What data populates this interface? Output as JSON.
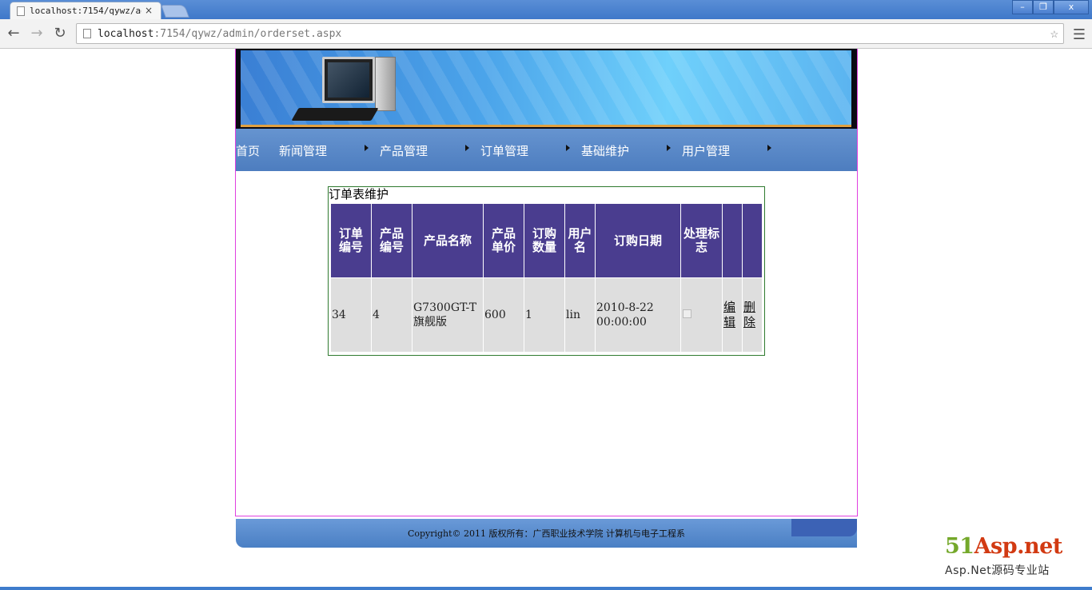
{
  "browser": {
    "tab_title": "localhost:7154/qywz/adm",
    "tab_close": "×",
    "url_host": "localhost",
    "url_rest": ":7154/qywz/admin/orderset.aspx",
    "btn_minimize": "–",
    "btn_restore": "❐",
    "btn_close": "x"
  },
  "nav": {
    "items": [
      {
        "label": "首页"
      },
      {
        "label": "新闻管理"
      },
      {
        "label": "产品管理"
      },
      {
        "label": "订单管理"
      },
      {
        "label": "基础维护"
      },
      {
        "label": "用户管理"
      }
    ]
  },
  "panel": {
    "title": "订单表维护"
  },
  "table": {
    "headers": [
      "订单编号",
      "产品编号",
      "产品名称",
      "产品单价",
      "订购数量",
      "用户名",
      "订购日期",
      "处理标志",
      "",
      ""
    ],
    "header_lines": [
      [
        "订单",
        "编号"
      ],
      [
        "产品",
        "编号"
      ],
      [
        "产品名称"
      ],
      [
        "产品",
        "单价"
      ],
      [
        "订购",
        "数量"
      ],
      [
        "用户",
        "名"
      ],
      [
        "订购日期"
      ],
      [
        "处理标",
        "志"
      ]
    ],
    "rows": [
      {
        "order_id": "34",
        "product_id": "4",
        "product_name": "G7300GT-T旗舰版",
        "price": "600",
        "quantity": "1",
        "username": "lin",
        "order_date": "2010-8-22 00:00:00",
        "processed": false,
        "edit_label": "编辑",
        "delete_label": "删除"
      }
    ]
  },
  "footer": {
    "text": "Copyright© 2011 版权所有：广西职业技术学院 计算机与电子工程系"
  },
  "watermark": {
    "main_prefix": "51",
    "main_rest": "Asp.net",
    "sub": "Asp.Net源码专业站"
  },
  "colors": {
    "header_bg": "#4a3d8f",
    "cell_bg": "#dedede",
    "nav_bg": "#5a88c8",
    "panel_border": "#2f7a2f",
    "page_border": "#e040e0"
  }
}
